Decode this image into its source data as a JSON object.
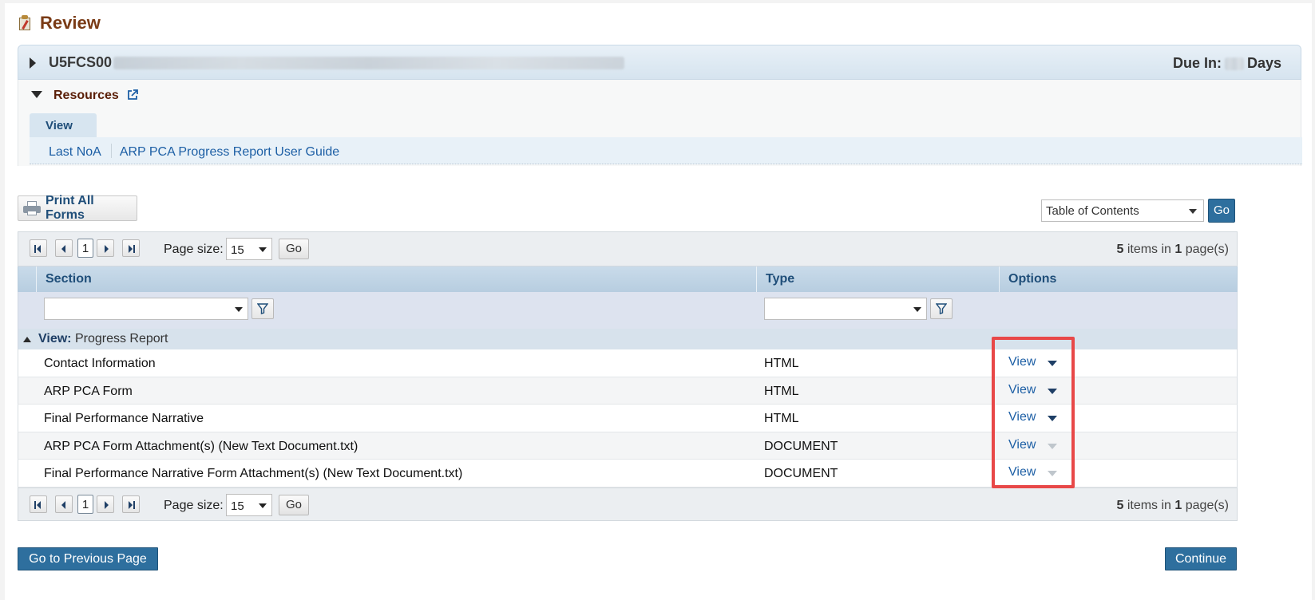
{
  "page": {
    "title": "Review"
  },
  "header": {
    "grant_prefix": "U5FCS00",
    "due_label": "Due In:",
    "due_suffix": "Days"
  },
  "resources": {
    "label": "Resources",
    "tab": "View",
    "links": [
      "Last NoA",
      "ARP PCA Progress Report User Guide"
    ]
  },
  "toolbar": {
    "print_all": "Print All Forms",
    "toc_selected": "Table of Contents",
    "toc_go": "Go"
  },
  "pager": {
    "current_page": "1",
    "page_size_label": "Page size:",
    "page_size": "15",
    "go": "Go",
    "items_count": "5",
    "items_text_1": " items in ",
    "pages_count": "1",
    "items_text_2": " page(s)"
  },
  "table": {
    "columns": [
      "Section",
      "Type",
      "Options"
    ],
    "group_label": "View:",
    "group_value": "Progress Report",
    "rows": [
      {
        "section": "Contact Information",
        "type": "HTML",
        "option": "View",
        "menu_enabled": true
      },
      {
        "section": "ARP PCA Form",
        "type": "HTML",
        "option": "View",
        "menu_enabled": true
      },
      {
        "section": "Final Performance Narrative",
        "type": "HTML",
        "option": "View",
        "menu_enabled": true
      },
      {
        "section": "ARP PCA Form Attachment(s) (New Text Document.txt)",
        "type": "DOCUMENT",
        "option": "View",
        "menu_enabled": false
      },
      {
        "section": "Final Performance Narrative Form Attachment(s) (New Text Document.txt)",
        "type": "DOCUMENT",
        "option": "View",
        "menu_enabled": false
      }
    ]
  },
  "footer": {
    "previous": "Go to Previous Page",
    "continue": "Continue"
  },
  "colors": {
    "title": "#7a3b16",
    "link": "#1d5fa5",
    "primary_button": "#2e6f9e",
    "highlight_box": "#e84848"
  },
  "icons": [
    "review-clipboard-icon",
    "expand-arrow-icon",
    "collapse-arrow-icon",
    "external-link-icon",
    "printer-icon",
    "filter-icon",
    "chevron-down-icon"
  ]
}
